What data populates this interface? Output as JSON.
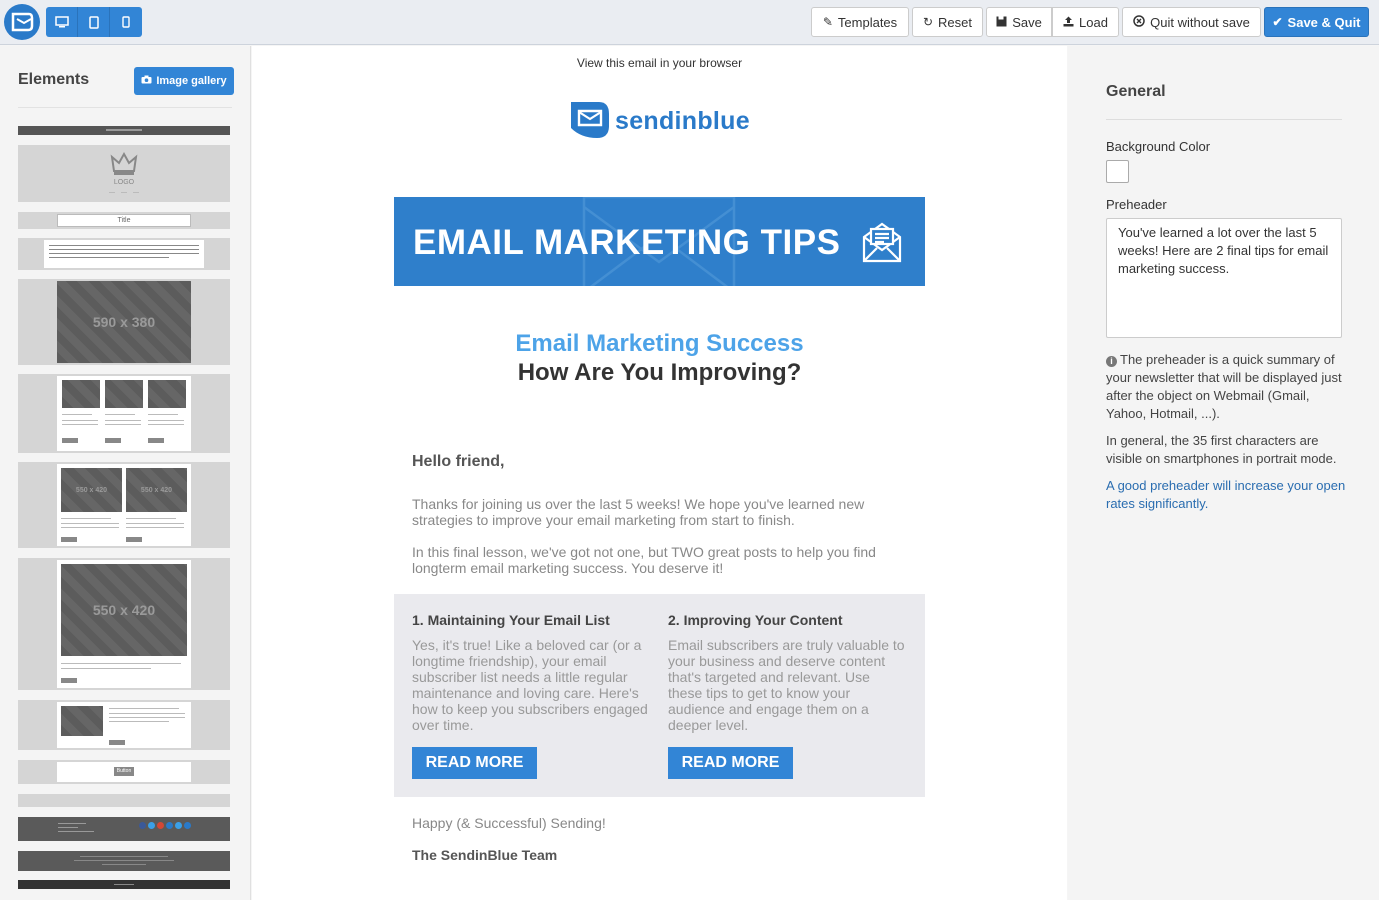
{
  "toolbar": {
    "devices": [
      "desktop-icon",
      "tablet-icon",
      "mobile-icon"
    ],
    "templates_label": "Templates",
    "reset_label": "Reset",
    "save_label": "Save",
    "load_label": "Load",
    "quit_label": "Quit without save",
    "save_quit_label": "Save & Quit"
  },
  "sidebar": {
    "title": "Elements",
    "gallery_label": "Image gallery",
    "blocks": {
      "logo_text": "LOGO",
      "title_text": "Title",
      "ph_590": "590 x 380",
      "ph_550": "550 x 420",
      "button_text": "Button"
    }
  },
  "email": {
    "view_in_browser": "View this email in your browser",
    "brand_name": "sendinblue",
    "hero_title": "EMAIL MARKETING TIPS",
    "subtitle_1": "Email Marketing Success",
    "subtitle_2": "How Are You Improving?",
    "greeting": "Hello friend,",
    "para_1": "Thanks for joining us over the last 5 weeks! We hope you've learned new strategies to improve your email marketing from start to finish.",
    "para_2": "In this final lesson, we've got not one, but TWO great posts to help you find longterm email marketing success. You deserve it!",
    "columns": [
      {
        "title": "1. Maintaining Your Email List",
        "text": "Yes, it's true! Like a beloved car (or a longtime friendship), your email subscriber list needs a little regular maintenance and loving care. Here's how to keep you subscribers engaged over time.",
        "button": "READ MORE"
      },
      {
        "title": "2. Improving Your Content",
        "text": "Email subscribers are truly valuable to your business and deserve content that's targeted and relevant. Use these tips to get to know your audience and engage them on a deeper level.",
        "button": "READ MORE"
      }
    ],
    "signoff": "Happy (& Successful) Sending!",
    "team": "The SendinBlue Team"
  },
  "settings": {
    "title": "General",
    "bg_color_label": "Background Color",
    "bg_color_value": "#ffffff",
    "preheader_label": "Preheader",
    "preheader_value": "You've learned a lot over the last 5 weeks! Here are 2 final tips for email marketing success.",
    "info_1": "The preheader is a quick summary of your newsletter that will be displayed just after the object on Webmail (Gmail, Yahoo, Hotmail, ...).",
    "info_2": "In general, the 35 first characters are visible on smartphones in portrait mode.",
    "info_3": "A good preheader will increase your open rates significantly."
  },
  "colors": {
    "accent": "#3285d6",
    "hero": "#2f7fcb",
    "subtitle": "#4da3e8"
  }
}
